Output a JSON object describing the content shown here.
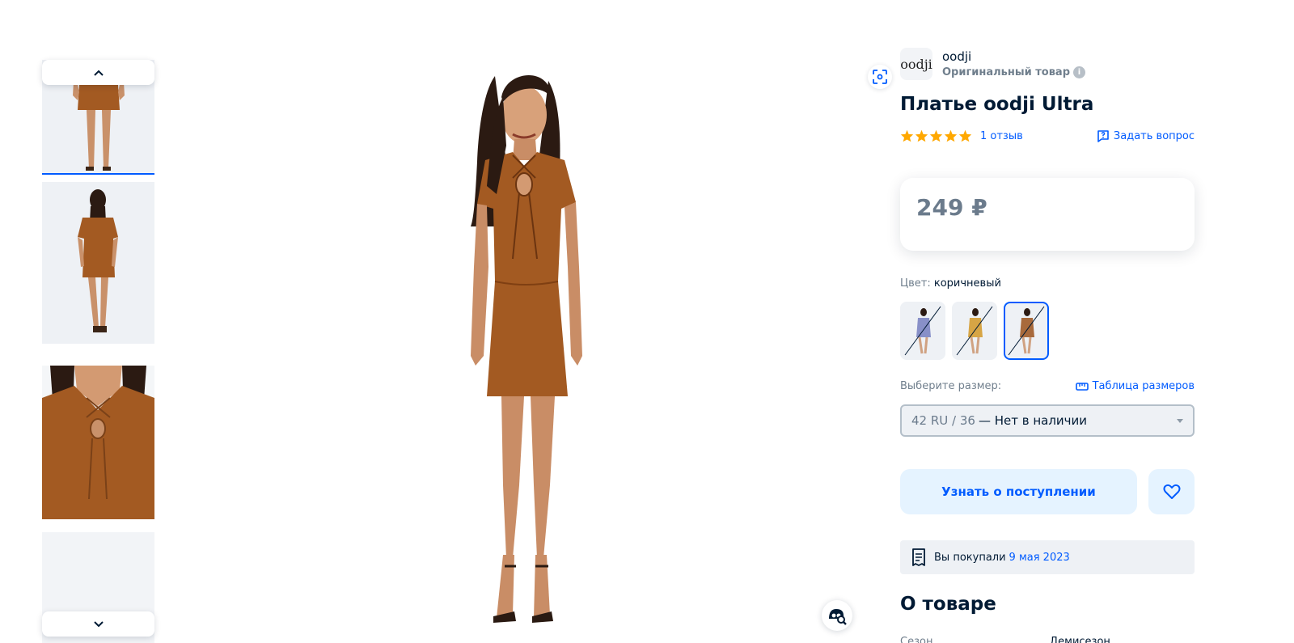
{
  "brand": {
    "name": "oodji",
    "logo_text": "oodji",
    "subtitle": "Оригинальный товар",
    "info_icon": "info-icon"
  },
  "product": {
    "title": "Платье oodji Ultra",
    "rating_stars": 5,
    "reviews_label": "1 отзыв",
    "ask_label": "Задать вопрос"
  },
  "price": {
    "value": "249 ₽"
  },
  "color": {
    "label": "Цвет:",
    "selected": "коричневый",
    "swatches": [
      {
        "name": "swatch-blue",
        "color": "#8890c8",
        "active": false
      },
      {
        "name": "swatch-mustard",
        "color": "#d7a545",
        "active": false
      },
      {
        "name": "swatch-brown",
        "color": "#a86a3c",
        "active": true
      }
    ]
  },
  "size": {
    "label": "Выберите размер:",
    "table_link": "Таблица размеров",
    "selected_value": "42 RU / 36",
    "selected_status": "— Нет в наличии"
  },
  "actions": {
    "notify_label": "Узнать о поступлении",
    "favorite_icon": "heart-icon"
  },
  "purchase": {
    "prefix": "Вы покупали",
    "date": "9 мая 2023"
  },
  "about": {
    "title": "О товаре",
    "specs": [
      {
        "key": "Сезон",
        "value": "Демисезон"
      }
    ]
  },
  "colors": {
    "accent": "#005bff",
    "dress": "#a35a22",
    "star": "#ffa800",
    "light_blue_bg": "#e5f3ff"
  }
}
